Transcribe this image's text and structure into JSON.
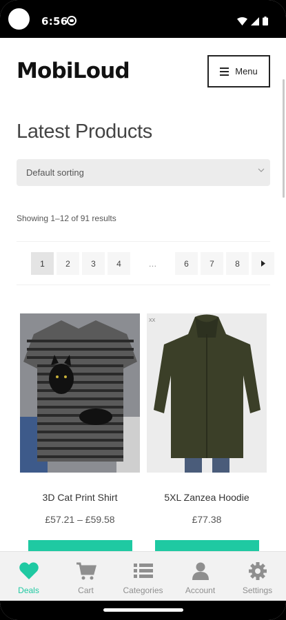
{
  "status": {
    "time": "6:56"
  },
  "header": {
    "logo": "MobiLoud",
    "menu_label": "Menu"
  },
  "main": {
    "title": "Latest Products",
    "sort_selected": "Default sorting",
    "results_text": "Showing 1–12 of 91 results",
    "pagination": [
      "1",
      "2",
      "3",
      "4",
      "…",
      "6",
      "7",
      "8"
    ],
    "current_page": "1"
  },
  "products": [
    {
      "name": "3D Cat Print Shirt",
      "price": "£57.21 – £59.58"
    },
    {
      "name": "5XL Zanzea Hoodie",
      "price": "£77.38"
    }
  ],
  "tabbar": {
    "items": [
      {
        "label": "Deals",
        "icon": "heart-icon"
      },
      {
        "label": "Cart",
        "icon": "cart-icon"
      },
      {
        "label": "Categories",
        "icon": "list-icon"
      },
      {
        "label": "Account",
        "icon": "person-icon"
      },
      {
        "label": "Settings",
        "icon": "gear-icon"
      }
    ]
  },
  "colors": {
    "accent": "#1fc9a2",
    "inactive": "#8f8f8f",
    "tabbar_bg": "#f2f2f2"
  }
}
